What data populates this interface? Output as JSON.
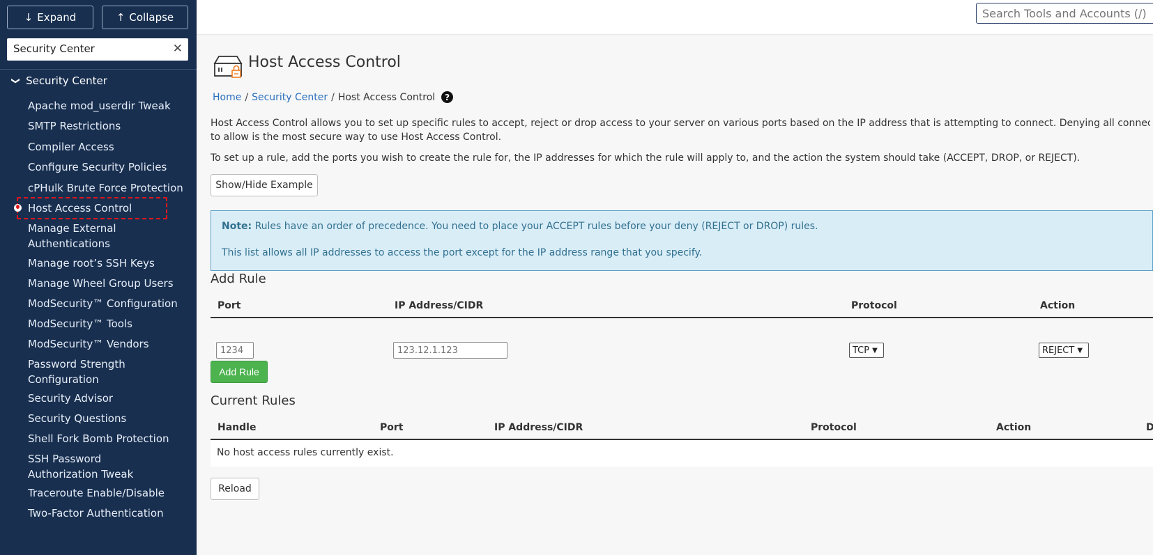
{
  "sidebar": {
    "expand_label": "Expand",
    "collapse_label": "Collapse",
    "filter_value": "Security Center",
    "clear_symbol": "✕",
    "group_label": "Security Center",
    "items": [
      {
        "label": "Apache mod_userdir Tweak"
      },
      {
        "label": "SMTP Restrictions"
      },
      {
        "label": "Compiler Access"
      },
      {
        "label": "Configure Security Policies"
      },
      {
        "label": "cPHulk Brute Force Protection"
      },
      {
        "label": "Host Access Control",
        "active": true
      },
      {
        "label": "Manage External Authentications"
      },
      {
        "label": "Manage root’s SSH Keys"
      },
      {
        "label": "Manage Wheel Group Users"
      },
      {
        "label": "ModSecurity™ Configuration"
      },
      {
        "label": "ModSecurity™ Tools"
      },
      {
        "label": "ModSecurity™ Vendors"
      },
      {
        "label": "Password Strength Configuration"
      },
      {
        "label": "Security Advisor"
      },
      {
        "label": "Security Questions"
      },
      {
        "label": "Shell Fork Bomb Protection"
      },
      {
        "label": "SSH Password Authorization Tweak"
      },
      {
        "label": "Traceroute Enable/Disable"
      },
      {
        "label": "Two-Factor Authentication"
      }
    ]
  },
  "topbar": {
    "search_placeholder": "Search Tools and Accounts (/)"
  },
  "page": {
    "title": "Host Access Control",
    "breadcrumb": {
      "home": "Home",
      "sep": "/",
      "section": "Security Center",
      "current": "Host Access Control",
      "help": "?"
    },
    "intro_1": "Host Access Control allows you to set up specific rules to accept, reject or drop access to your server on various ports based on the IP address that is attempting to connect. Denying all connections and only all",
    "intro_1b": "to allow is the most secure way to use Host Access Control.",
    "intro_2": "To set up a rule, add the ports you wish to create the rule for, the IP addresses for which the rule will apply to, and the action the system should take (ACCEPT, DROP, or REJECT).",
    "show_hide_label": "Show/Hide Example",
    "note": {
      "label": "Note:",
      "line1": " Rules have an order of precedence. You need to place your ACCEPT rules before your deny (REJECT or DROP) rules.",
      "line2": "This list allows all IP addresses to access the port except for the IP address range that you specify."
    },
    "add_rule": {
      "heading": "Add Rule",
      "columns": [
        "Port",
        "IP Address/CIDR",
        "Protocol",
        "Action"
      ],
      "port_placeholder": "1234",
      "ip_placeholder": "123.12.1.123",
      "protocol_value": "TCP",
      "action_value": "REJECT",
      "button_label": "Add Rule"
    },
    "current_rules": {
      "heading": "Current Rules",
      "columns": [
        "Handle",
        "Port",
        "IP Address/CIDR",
        "Protocol",
        "Action",
        "D"
      ],
      "empty_message": "No host access rules currently exist.",
      "reload_label": "Reload"
    }
  },
  "colors": {
    "sidebar_bg": "#182f50",
    "accent_link": "#2a6fbd",
    "success": "#4cb34f",
    "note_bg": "#d9edf7",
    "active_outline": "#e0161d"
  }
}
